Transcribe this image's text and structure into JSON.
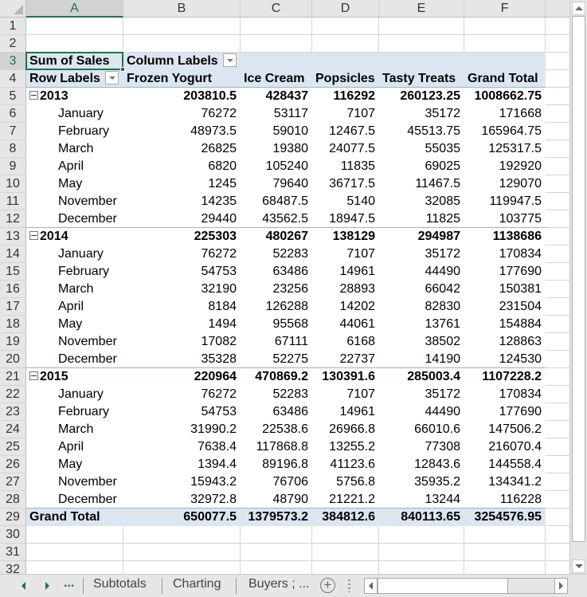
{
  "columns": [
    "A",
    "B",
    "C",
    "D",
    "E",
    "F"
  ],
  "row_numbers": [
    1,
    2,
    3,
    4,
    5,
    6,
    7,
    8,
    9,
    10,
    11,
    12,
    13,
    14,
    15,
    16,
    17,
    18,
    19,
    20,
    21,
    22,
    23,
    24,
    25,
    26,
    27,
    28,
    29,
    30,
    31,
    32
  ],
  "active_cell": "A3",
  "pivot": {
    "value_field": "Sum of Sales",
    "column_labels_caption": "Column Labels",
    "row_labels_caption": "Row Labels",
    "column_headers": [
      "Frozen Yogurt",
      "Ice Cream",
      "Popsicles",
      "Tasty Treats",
      "Grand Total"
    ],
    "groups": [
      {
        "label": "2013",
        "totals": [
          "203810.5",
          "428437",
          "116292",
          "260123.25",
          "1008662.75"
        ],
        "rows": [
          {
            "label": "January",
            "values": [
              "76272",
              "53117",
              "7107",
              "35172",
              "171668"
            ]
          },
          {
            "label": "February",
            "values": [
              "48973.5",
              "59010",
              "12467.5",
              "45513.75",
              "165964.75"
            ]
          },
          {
            "label": "March",
            "values": [
              "26825",
              "19380",
              "24077.5",
              "55035",
              "125317.5"
            ]
          },
          {
            "label": "April",
            "values": [
              "6820",
              "105240",
              "11835",
              "69025",
              "192920"
            ]
          },
          {
            "label": "May",
            "values": [
              "1245",
              "79640",
              "36717.5",
              "11467.5",
              "129070"
            ]
          },
          {
            "label": "November",
            "values": [
              "14235",
              "68487.5",
              "5140",
              "32085",
              "119947.5"
            ]
          },
          {
            "label": "December",
            "values": [
              "29440",
              "43562.5",
              "18947.5",
              "11825",
              "103775"
            ]
          }
        ]
      },
      {
        "label": "2014",
        "totals": [
          "225303",
          "480267",
          "138129",
          "294987",
          "1138686"
        ],
        "rows": [
          {
            "label": "January",
            "values": [
              "76272",
              "52283",
              "7107",
              "35172",
              "170834"
            ]
          },
          {
            "label": "February",
            "values": [
              "54753",
              "63486",
              "14961",
              "44490",
              "177690"
            ]
          },
          {
            "label": "March",
            "values": [
              "32190",
              "23256",
              "28893",
              "66042",
              "150381"
            ]
          },
          {
            "label": "April",
            "values": [
              "8184",
              "126288",
              "14202",
              "82830",
              "231504"
            ]
          },
          {
            "label": "May",
            "values": [
              "1494",
              "95568",
              "44061",
              "13761",
              "154884"
            ]
          },
          {
            "label": "November",
            "values": [
              "17082",
              "67111",
              "6168",
              "38502",
              "128863"
            ]
          },
          {
            "label": "December",
            "values": [
              "35328",
              "52275",
              "22737",
              "14190",
              "124530"
            ]
          }
        ]
      },
      {
        "label": "2015",
        "totals": [
          "220964",
          "470869.2",
          "130391.6",
          "285003.4",
          "1107228.2"
        ],
        "rows": [
          {
            "label": "January",
            "values": [
              "76272",
              "52283",
              "7107",
              "35172",
              "170834"
            ]
          },
          {
            "label": "February",
            "values": [
              "54753",
              "63486",
              "14961",
              "44490",
              "177690"
            ]
          },
          {
            "label": "March",
            "values": [
              "31990.2",
              "22538.6",
              "26966.8",
              "66010.6",
              "147506.2"
            ]
          },
          {
            "label": "April",
            "values": [
              "7638.4",
              "117868.8",
              "13255.2",
              "77308",
              "216070.4"
            ]
          },
          {
            "label": "May",
            "values": [
              "1394.4",
              "89196.8",
              "41123.6",
              "12843.6",
              "144558.4"
            ]
          },
          {
            "label": "November",
            "values": [
              "15943.2",
              "76706",
              "5756.8",
              "35935.2",
              "134341.2"
            ]
          },
          {
            "label": "December",
            "values": [
              "32972.8",
              "48790",
              "21221.2",
              "13244",
              "116228"
            ]
          }
        ]
      }
    ],
    "grand_total": {
      "label": "Grand Total",
      "values": [
        "650077.5",
        "1379573.2",
        "384812.6",
        "840113.65",
        "3254576.95"
      ]
    }
  },
  "sheet_tabs": {
    "more_label": "...",
    "tabs": [
      "Subtotals",
      "Charting",
      "Buyers ; ..."
    ],
    "add_symbol": "+"
  },
  "colors": {
    "accent": "#217346",
    "pivot_band": "#dce6f1",
    "pivot_line": "#95b3d7"
  }
}
